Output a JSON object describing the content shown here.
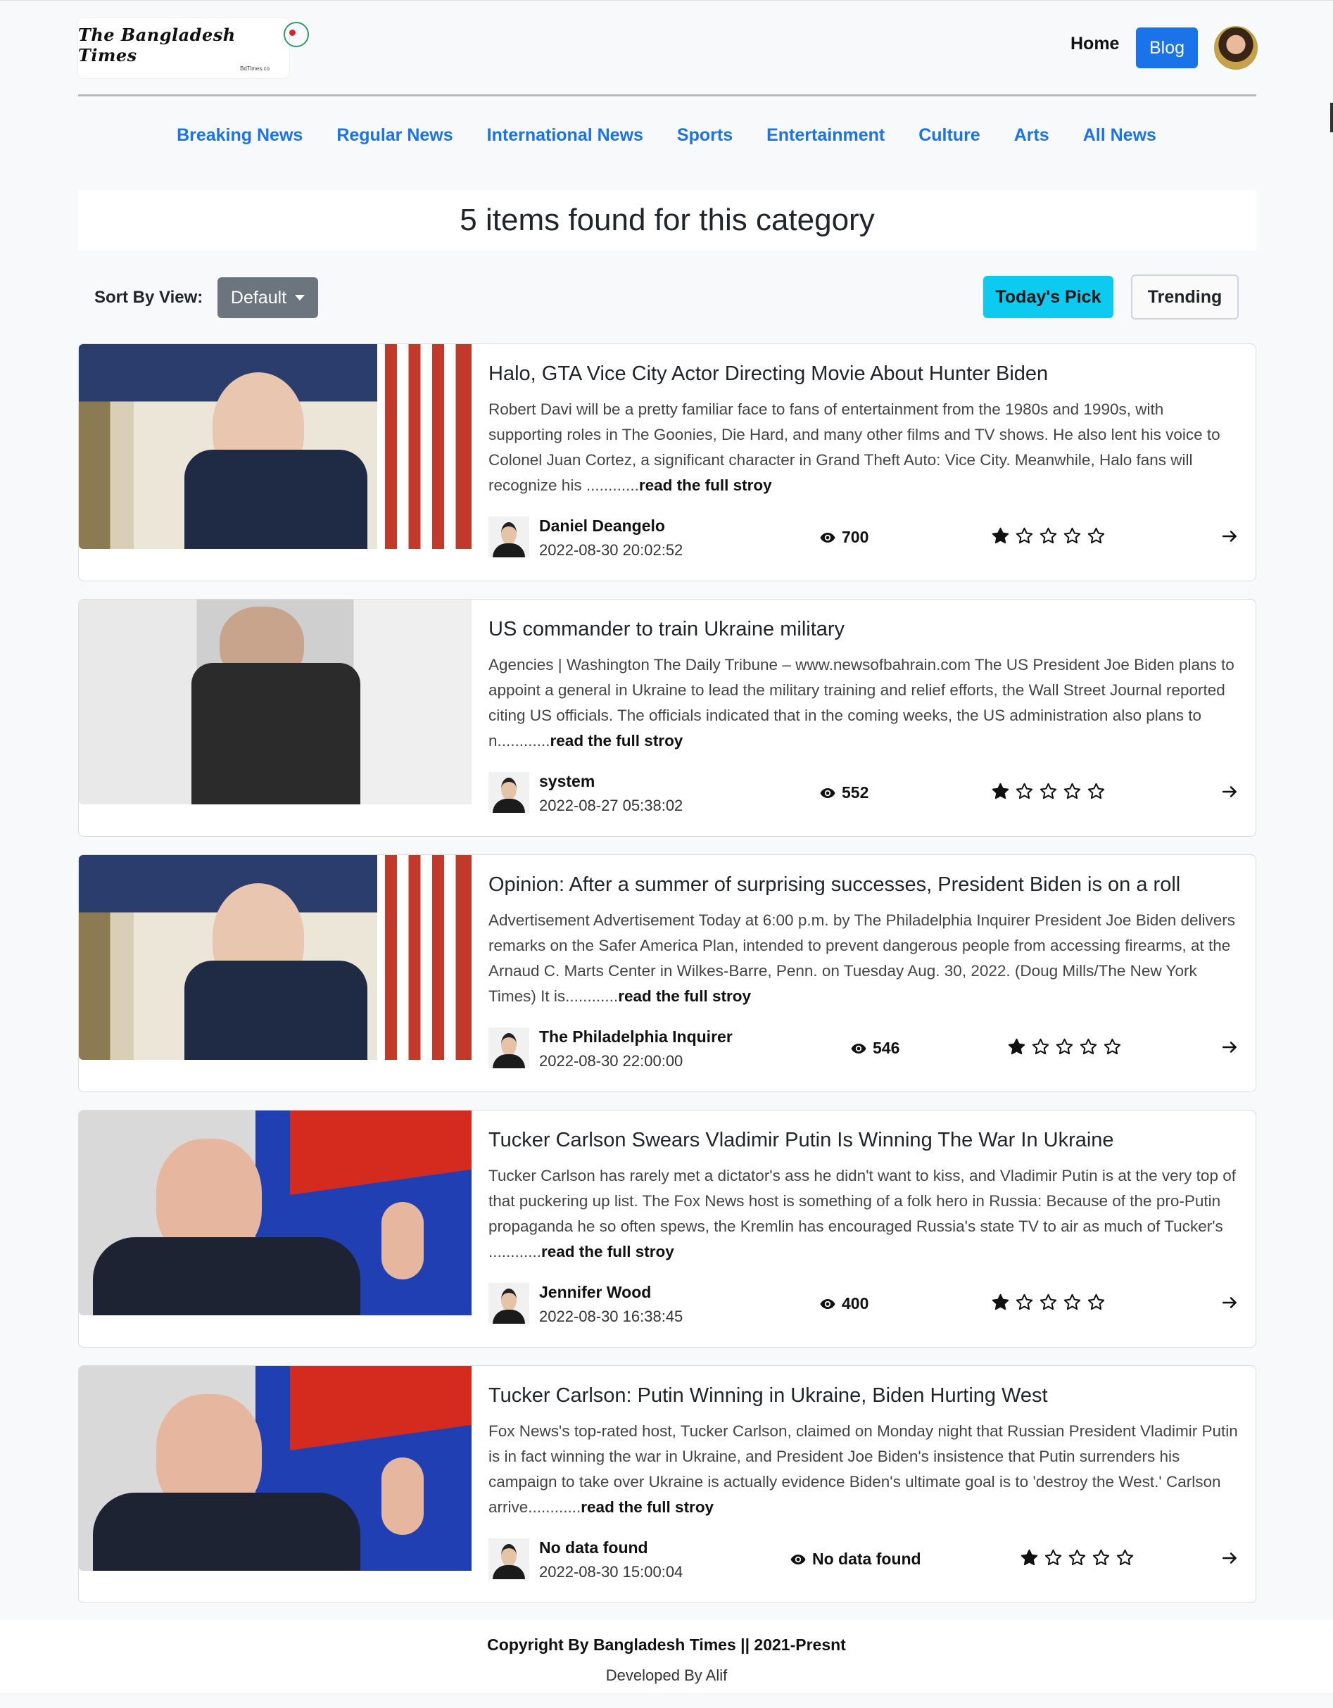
{
  "header": {
    "logo_text": "The Bangladesh Times",
    "logo_sub": "BdTimes.co",
    "home_label": "Home",
    "blog_label": "Blog"
  },
  "categories": [
    "Breaking News",
    "Regular News",
    "International News",
    "Sports",
    "Entertainment",
    "Culture",
    "Arts",
    "All News"
  ],
  "results": {
    "count_text": "5 items found for this category"
  },
  "controls": {
    "sort_label": "Sort By View:",
    "sort_value": "Default",
    "todays_pick_label": "Today's Pick",
    "trending_label": "Trending"
  },
  "colors": {
    "link_blue": "#1a73e8",
    "info_cyan": "#0dcaf0",
    "secondary_gray": "#6c757d"
  },
  "articles": [
    {
      "title": "Halo, GTA Vice City Actor Directing Movie About Hunter Biden",
      "description": "Robert Davi will be a pretty familiar face to fans of entertainment from the 1980s and 1990s, with supporting roles in The Goonies, Die Hard, and many other films and TV shows. He also lent his voice to Colonel Juan Cortez, a significant character in Grand Theft Auto: Vice City. Meanwhile, Halo fans will recognize his ............",
      "read_more": "read the full stroy",
      "author": "Daniel Deangelo",
      "date": "2022-08-30 20:02:52",
      "views": "700",
      "rating": 1,
      "image": "biden-podium-photo"
    },
    {
      "title": "US commander to train Ukraine military",
      "description": "Agencies | Washington The Daily Tribune – www.newsofbahrain.com The US President Joe Biden plans to appoint a general in Ukraine to lead the military training and relief efforts, the Wall Street Journal reported citing US officials. The officials indicated that in the coming weeks, the US administration also plans to n............",
      "read_more": "read the full stroy",
      "author": "system",
      "date": "2022-08-27 05:38:02",
      "views": "552",
      "rating": 1,
      "image": "tattooed-man-photo"
    },
    {
      "title": "Opinion: After a summer of surprising successes, President Biden is on a roll",
      "description": "Advertisement Advertisement Today at 6:00 p.m. by The Philadelphia Inquirer President Joe Biden delivers remarks on the Safer America Plan, intended to prevent dangerous people from accessing firearms, at the Arnaud C. Marts Center in Wilkes-Barre, Penn. on Tuesday Aug. 30, 2022. (Doug Mills/The New York Times) It is............",
      "read_more": "read the full stroy",
      "author": "The Philadelphia Inquirer",
      "date": "2022-08-30 22:00:00",
      "views": "546",
      "rating": 1,
      "image": "biden-podium-photo"
    },
    {
      "title": "Tucker Carlson Swears Vladimir Putin Is Winning The War In Ukraine",
      "description": "Tucker Carlson has rarely met a dictator's ass he didn't want to kiss, and Vladimir Putin is at the very top of that puckering up list. The Fox News host is something of a folk hero in Russia: Because of the pro-Putin propaganda he so often spews, the Kremlin has encouraged Russia's state TV to air as much of Tucker's ............",
      "read_more": "read the full stroy",
      "author": "Jennifer Wood",
      "date": "2022-08-30 16:38:45",
      "views": "400",
      "rating": 1,
      "image": "putin-speaking-photo"
    },
    {
      "title": "Tucker Carlson: Putin Winning in Ukraine, Biden Hurting West",
      "description": "Fox News's top-rated host, Tucker Carlson, claimed on Monday night that Russian President Vladimir Putin is in fact winning the war in Ukraine, and President Joe Biden's insistence that Putin surrenders his campaign to take over Ukraine is actually evidence Biden's ultimate goal is to 'destroy the West.' Carlson arrive............",
      "read_more": "read the full stroy",
      "author": "No data found",
      "date": "2022-08-30 15:00:04",
      "views": "No data found",
      "rating": 1,
      "image": "putin-speaking-photo"
    }
  ],
  "footer": {
    "copyright": "Copyright By Bangladesh Times || 2021-Presnt",
    "developer": "Developed By Alif"
  }
}
